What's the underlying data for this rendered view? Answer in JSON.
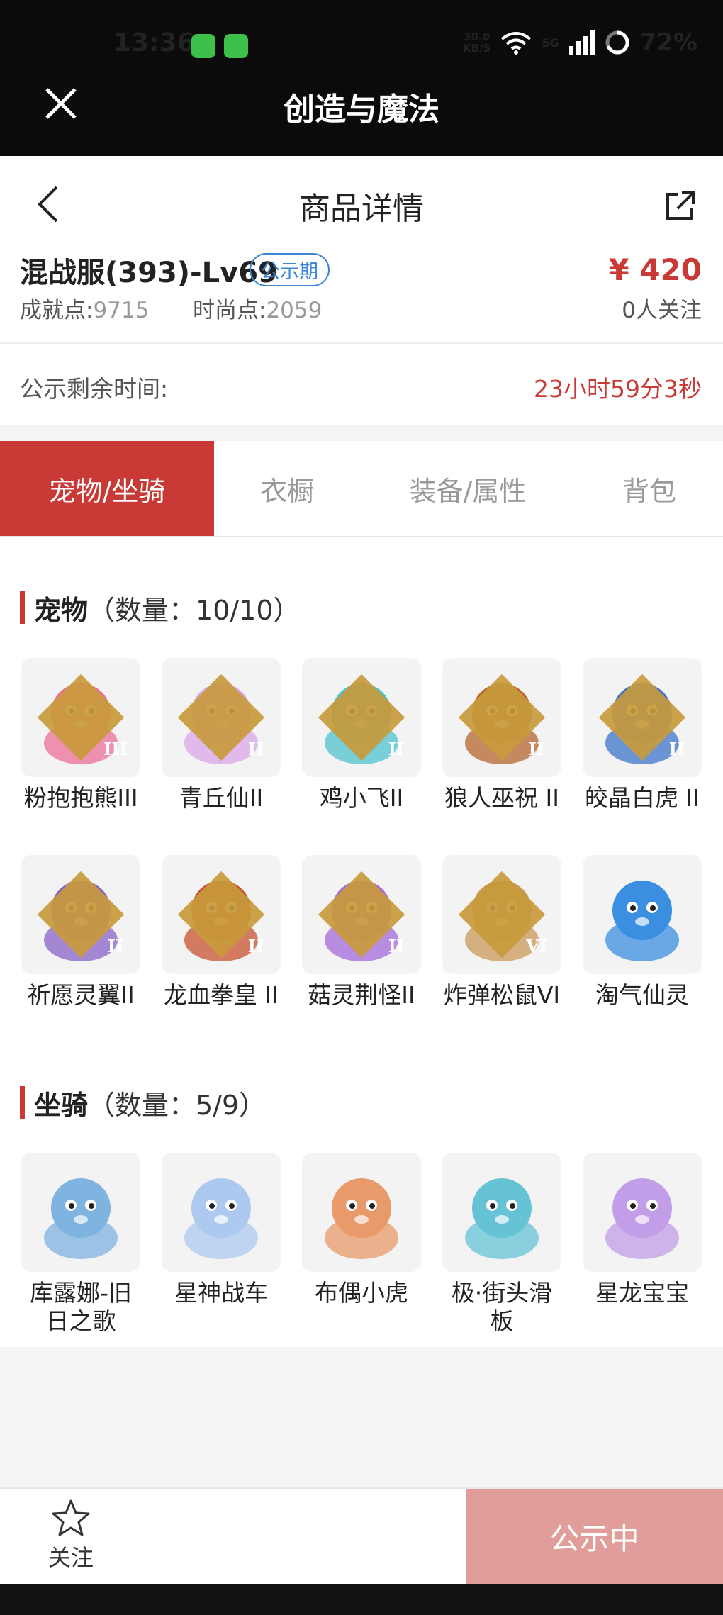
{
  "status_bar": {
    "time": "13:36",
    "net_speed_value": "30.0",
    "net_speed_unit": "KB/S",
    "network": "5G",
    "battery": "72%"
  },
  "app": {
    "title": "创造与魔法"
  },
  "header": {
    "title": "商品详情"
  },
  "product": {
    "server": "混战服(393)-Lv69",
    "badge": "公示期",
    "price": "¥ 420",
    "achievement_label": "成就点:",
    "achievement_value": "9715",
    "fashion_label": "时尚点:",
    "fashion_value": "2059",
    "followers": "0人关注"
  },
  "countdown": {
    "label": "公示剩余时间:",
    "value": "23小时59分3秒"
  },
  "tabs": [
    {
      "label": "宠物/坐骑",
      "active": true
    },
    {
      "label": "衣橱",
      "active": false
    },
    {
      "label": "装备/属性",
      "active": false
    },
    {
      "label": "背包",
      "active": false
    }
  ],
  "pets": {
    "title": "宠物",
    "count": "（数量：10/10）",
    "items": [
      {
        "name": "粉抱抱熊III",
        "rank": "III",
        "color": "#ec6f9a"
      },
      {
        "name": "青丘仙II",
        "rank": "II",
        "color": "#d9a7e8"
      },
      {
        "name": "鸡小飞II",
        "rank": "II",
        "color": "#4fc3cf"
      },
      {
        "name": "狼人巫祝 II",
        "rank": "II",
        "color": "#b5652f"
      },
      {
        "name": "皎晶白虎 II",
        "rank": "II",
        "color": "#3c74c9"
      },
      {
        "name": "祈愿灵翼II",
        "rank": "II",
        "color": "#8a63c8"
      },
      {
        "name": "龙血拳皇 II",
        "rank": "II",
        "color": "#c8532f"
      },
      {
        "name": "菇灵荆怪II",
        "rank": "II",
        "color": "#a46ad9"
      },
      {
        "name": "炸弹松鼠VI",
        "rank": "VI",
        "color": "#c9985a"
      },
      {
        "name": "淘气仙灵",
        "rank": "",
        "color": "#3b8fe0"
      }
    ]
  },
  "mounts": {
    "title": "坐骑",
    "count": "（数量：5/9）",
    "items": [
      {
        "name": "库露娜-旧日之歌",
        "color": "#7fb3e0"
      },
      {
        "name": "星神战车",
        "color": "#aec9ef"
      },
      {
        "name": "布偶小虎",
        "color": "#e89a6a"
      },
      {
        "name": "极·街头滑板",
        "color": "#66c3d6"
      },
      {
        "name": "星龙宝宝",
        "color": "#c29ee8"
      }
    ]
  },
  "bottom": {
    "favorite_label": "关注",
    "status_button": "公示中"
  },
  "colors": {
    "accent": "#c93a36",
    "badge_blue": "#3b86d6",
    "button_disabled": "#e19d9a",
    "rank_gold": "#c89a3c"
  }
}
